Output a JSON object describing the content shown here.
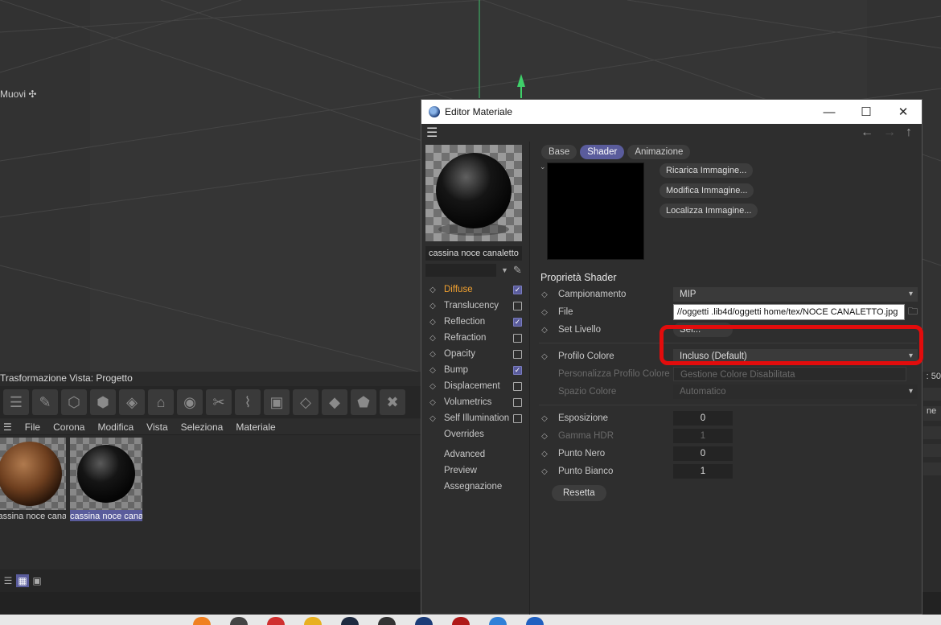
{
  "viewport": {
    "move_label": "Muovi ✣",
    "status": "Trasformazione Vista: Progetto",
    "right_readout": ": 50",
    "right_panel_text": "ne"
  },
  "material_manager": {
    "menu": [
      "File",
      "Corona",
      "Modifica",
      "Vista",
      "Seleziona",
      "Materiale"
    ],
    "materials": [
      {
        "name": "cassina noce cana",
        "selected": false,
        "kind": "wood"
      },
      {
        "name": "cassina noce cana",
        "selected": true,
        "kind": "black"
      }
    ]
  },
  "editor": {
    "title": "Editor Materiale",
    "material_name": "cassina noce canaletto",
    "channels": [
      {
        "label": "Diffuse",
        "checked": true,
        "active": true
      },
      {
        "label": "Translucency",
        "checked": false,
        "active": false
      },
      {
        "label": "Reflection",
        "checked": true,
        "active": false
      },
      {
        "label": "Refraction",
        "checked": false,
        "active": false
      },
      {
        "label": "Opacity",
        "checked": false,
        "active": false
      },
      {
        "label": "Bump",
        "checked": true,
        "active": false
      },
      {
        "label": "Displacement",
        "checked": false,
        "active": false
      },
      {
        "label": "Volumetrics",
        "checked": false,
        "active": false
      },
      {
        "label": "Self Illumination",
        "checked": false,
        "active": false
      }
    ],
    "extras": [
      "Overrides",
      "Advanced",
      "Preview",
      "Assegnazione"
    ],
    "tabs": [
      {
        "label": "Base",
        "active": false
      },
      {
        "label": "Shader",
        "active": true
      },
      {
        "label": "Animazione",
        "active": false
      }
    ],
    "shader_buttons": [
      "Ricarica Immagine...",
      "Modifica Immagine...",
      "Localizza Immagine..."
    ],
    "section_title": "Proprietà Shader",
    "props": {
      "campionamento_label": "Campionamento",
      "campionamento_value": "MIP",
      "file_label": "File",
      "file_value": "//oggetti .lib4d/oggetti home/tex/NOCE CANALETTO.jpg",
      "set_livello_label": "Set Livello",
      "set_livello_value": "Sel...",
      "profilo_label": "Profilo Colore",
      "profilo_value": "Incluso (Default)",
      "personalizza_label": "Personalizza Profilo Colore",
      "personalizza_value": "Gestione Colore Disabilitata",
      "spazio_label": "Spazio Colore",
      "spazio_value": "Automatico",
      "esposizione_label": "Esposizione",
      "esposizione_value": "0",
      "gamma_label": "Gamma HDR",
      "gamma_value": "1",
      "punto_nero_label": "Punto Nero",
      "punto_nero_value": "0",
      "punto_bianco_label": "Punto Bianco",
      "punto_bianco_value": "1"
    },
    "reset_label": "Resetta"
  },
  "colors": {
    "accent": "#5a5c9c",
    "active_channel": "#f0a030",
    "annotation": "#e20c0c"
  }
}
